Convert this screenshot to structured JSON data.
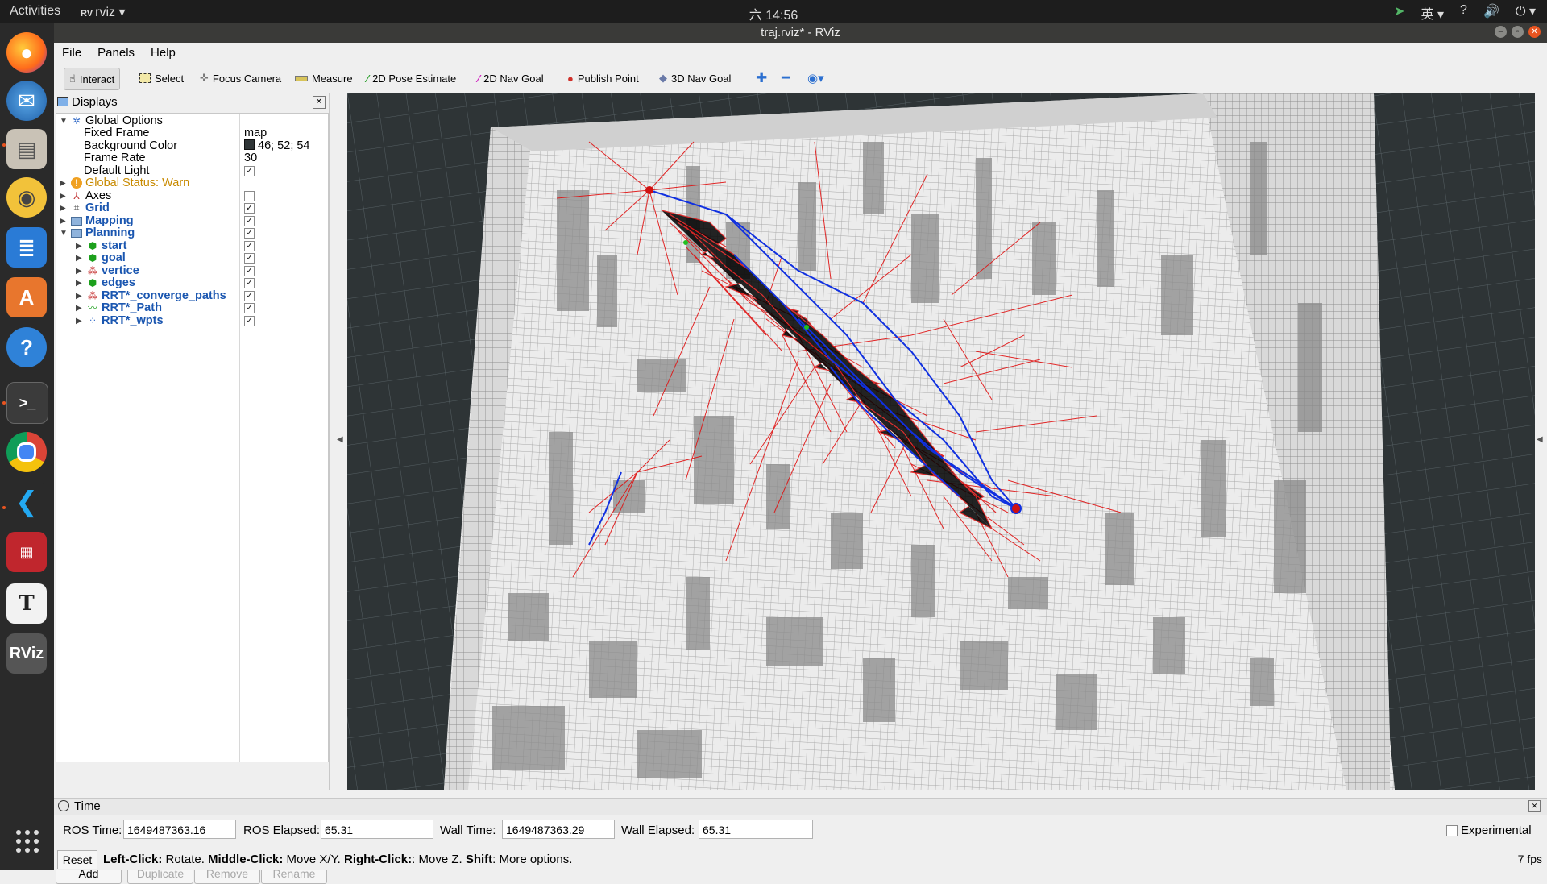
{
  "topbar": {
    "activities": "Activities",
    "app_name": "rviz ▾",
    "clock": "六 14:56",
    "input_method": "英 ▾"
  },
  "window": {
    "title": "traj.rviz* - RViz"
  },
  "menu": [
    "File",
    "Panels",
    "Help"
  ],
  "toolbar": {
    "interact": "Interact",
    "select": "Select",
    "focus_camera": "Focus Camera",
    "measure": "Measure",
    "pose_estimate": "2D Pose Estimate",
    "nav_goal_2d": "2D Nav Goal",
    "publish_point": "Publish Point",
    "nav_goal_3d": "3D Nav Goal"
  },
  "displays": {
    "title": "Displays",
    "global_options": "Global Options",
    "fixed_frame_label": "Fixed Frame",
    "fixed_frame": "map",
    "bg_color_label": "Background Color",
    "bg_color": "46; 52; 54",
    "bg_color_hex": "#2e3436",
    "frame_rate_label": "Frame Rate",
    "frame_rate": "30",
    "default_light_label": "Default Light",
    "global_status": "Global Status: Warn",
    "axes": "Axes",
    "grid": "Grid",
    "mapping": "Mapping",
    "planning": "Planning",
    "children": [
      "start",
      "goal",
      "vertice",
      "edges",
      "RRT*_converge_paths",
      "RRT*_Path",
      "RRT*_wpts"
    ],
    "buttons": {
      "add": "Add",
      "duplicate": "Duplicate",
      "remove": "Remove",
      "rename": "Rename"
    }
  },
  "time": {
    "title": "Time",
    "ros_time_label": "ROS Time:",
    "ros_time": "1649487363.16",
    "ros_elapsed_label": "ROS Elapsed:",
    "ros_elapsed": "65.31",
    "wall_time_label": "Wall Time:",
    "wall_time": "1649487363.29",
    "wall_elapsed_label": "Wall Elapsed:",
    "wall_elapsed": "65.31",
    "experimental": "Experimental"
  },
  "status": {
    "reset": "Reset",
    "left_click": "Left-Click:",
    "rotate": " Rotate. ",
    "middle_click": "Middle-Click:",
    "move_xy": " Move X/Y. ",
    "right_click": "Right-Click:",
    "move_z": ": Move Z. ",
    "shift": "Shift",
    "more": ": More options.",
    "fps": "7 fps"
  },
  "colors": {
    "accent": "#e95420",
    "tree_blue": "#1a56b0",
    "path_red": "#e01010",
    "path_blue": "#1030e0"
  }
}
